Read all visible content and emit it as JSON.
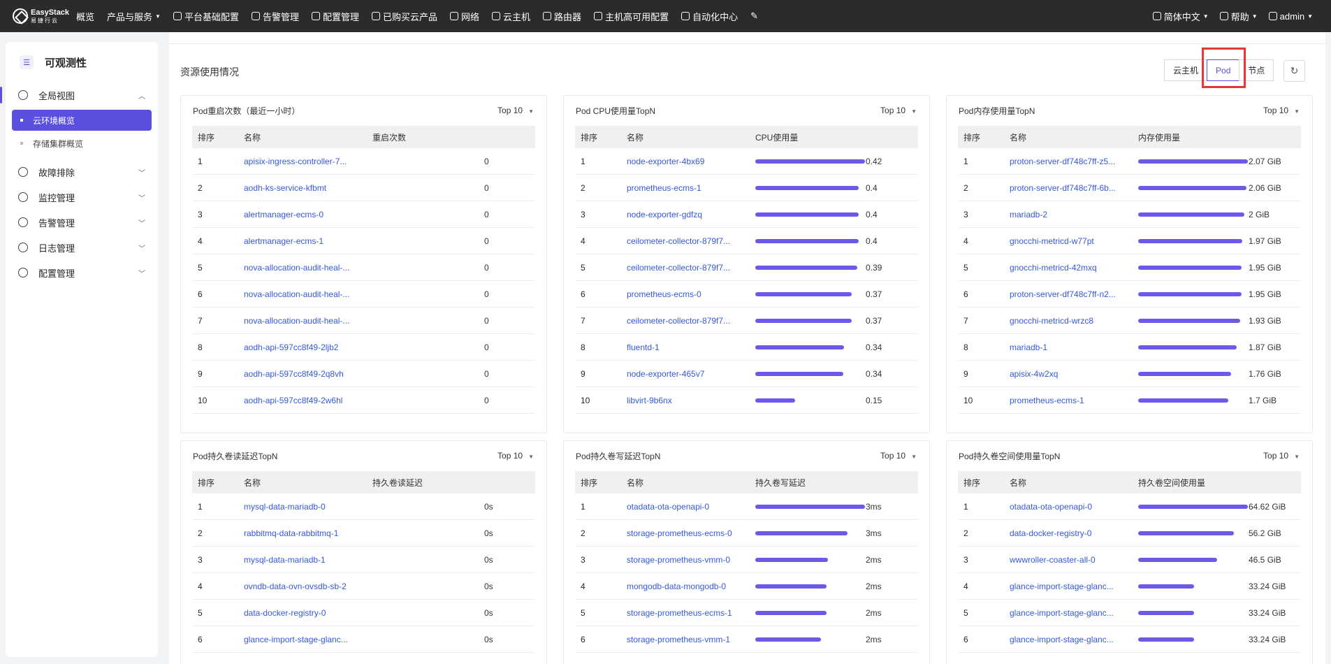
{
  "topbar": {
    "logo_text": "EasyStack",
    "logo_sub": "易捷行云",
    "nav": [
      "概览",
      "产品与服务",
      "平台基础配置",
      "告警管理",
      "配置管理",
      "已购买云产品",
      "网络",
      "云主机",
      "路由器",
      "主机高可用配置",
      "自动化中心"
    ],
    "lang": "简体中文",
    "help": "帮助",
    "user": "admin"
  },
  "sidebar": {
    "title": "可观测性",
    "groups": [
      {
        "label": "全局视图",
        "expanded": true,
        "subs": [
          {
            "label": "云环境概览",
            "active": true
          },
          {
            "label": "存储集群概览",
            "active": false
          }
        ]
      },
      {
        "label": "故障排除"
      },
      {
        "label": "监控管理"
      },
      {
        "label": "告警管理"
      },
      {
        "label": "日志管理"
      },
      {
        "label": "配置管理"
      }
    ]
  },
  "main": {
    "section_title": "资源使用情况",
    "tabs": [
      "云主机",
      "Pod",
      "节点"
    ],
    "active_tab": "Pod"
  },
  "panels": [
    {
      "title": "Pod重启次数（最近一小时）",
      "topn": "Top 10",
      "headers": [
        "排序",
        "名称",
        "重启次数"
      ],
      "bars": false,
      "rows": [
        {
          "i": "1",
          "name": "apisix-ingress-controller-7...",
          "val": "0",
          "pct": 0
        },
        {
          "i": "2",
          "name": "aodh-ks-service-kfbmt",
          "val": "0",
          "pct": 0
        },
        {
          "i": "3",
          "name": "alertmanager-ecms-0",
          "val": "0",
          "pct": 0
        },
        {
          "i": "4",
          "name": "alertmanager-ecms-1",
          "val": "0",
          "pct": 0
        },
        {
          "i": "5",
          "name": "nova-allocation-audit-heal-...",
          "val": "0",
          "pct": 0
        },
        {
          "i": "6",
          "name": "nova-allocation-audit-heal-...",
          "val": "0",
          "pct": 0
        },
        {
          "i": "7",
          "name": "nova-allocation-audit-heal-...",
          "val": "0",
          "pct": 0
        },
        {
          "i": "8",
          "name": "aodh-api-597cc8f49-2ljb2",
          "val": "0",
          "pct": 0
        },
        {
          "i": "9",
          "name": "aodh-api-597cc8f49-2q8vh",
          "val": "0",
          "pct": 0
        },
        {
          "i": "10",
          "name": "aodh-api-597cc8f49-2w6hl",
          "val": "0",
          "pct": 0
        }
      ]
    },
    {
      "title": "Pod CPU使用量TopN",
      "topn": "Top 10",
      "headers": [
        "排序",
        "名称",
        "CPU使用量"
      ],
      "bars": true,
      "rows": [
        {
          "i": "1",
          "name": "node-exporter-4bx69",
          "val": "0.42",
          "pct": 1.0
        },
        {
          "i": "2",
          "name": "prometheus-ecms-1",
          "val": "0.4",
          "pct": 0.94
        },
        {
          "i": "3",
          "name": "node-exporter-gdfzq",
          "val": "0.4",
          "pct": 0.94
        },
        {
          "i": "4",
          "name": "ceilometer-collector-879f7...",
          "val": "0.4",
          "pct": 0.94
        },
        {
          "i": "5",
          "name": "ceilometer-collector-879f7...",
          "val": "0.39",
          "pct": 0.93
        },
        {
          "i": "6",
          "name": "prometheus-ecms-0",
          "val": "0.37",
          "pct": 0.88
        },
        {
          "i": "7",
          "name": "ceilometer-collector-879f7...",
          "val": "0.37",
          "pct": 0.88
        },
        {
          "i": "8",
          "name": "fluentd-1",
          "val": "0.34",
          "pct": 0.81
        },
        {
          "i": "9",
          "name": "node-exporter-465v7",
          "val": "0.34",
          "pct": 0.8
        },
        {
          "i": "10",
          "name": "libvirt-9b6nx",
          "val": "0.15",
          "pct": 0.36
        }
      ]
    },
    {
      "title": "Pod内存使用量TopN",
      "topn": "Top 10",
      "headers": [
        "排序",
        "名称",
        "内存使用量"
      ],
      "bars": true,
      "rows": [
        {
          "i": "1",
          "name": "proton-server-df748c7ff-z5...",
          "val": "2.07 GiB",
          "pct": 1.0
        },
        {
          "i": "2",
          "name": "proton-server-df748c7ff-6b...",
          "val": "2.06 GiB",
          "pct": 0.99
        },
        {
          "i": "3",
          "name": "mariadb-2",
          "val": "2 GiB",
          "pct": 0.97
        },
        {
          "i": "4",
          "name": "gnocchi-metricd-w77pt",
          "val": "1.97 GiB",
          "pct": 0.95
        },
        {
          "i": "5",
          "name": "gnocchi-metricd-42mxq",
          "val": "1.95 GiB",
          "pct": 0.94
        },
        {
          "i": "6",
          "name": "proton-server-df748c7ff-n2...",
          "val": "1.95 GiB",
          "pct": 0.94
        },
        {
          "i": "7",
          "name": "gnocchi-metricd-wrzc8",
          "val": "1.93 GiB",
          "pct": 0.93
        },
        {
          "i": "8",
          "name": "mariadb-1",
          "val": "1.87 GiB",
          "pct": 0.9
        },
        {
          "i": "9",
          "name": "apisix-4w2xq",
          "val": "1.76 GiB",
          "pct": 0.85
        },
        {
          "i": "10",
          "name": "prometheus-ecms-1",
          "val": "1.7 GiB",
          "pct": 0.82
        }
      ]
    },
    {
      "title": "Pod持久卷读延迟TopN",
      "topn": "Top 10",
      "headers": [
        "排序",
        "名称",
        "持久卷读延迟"
      ],
      "bars": false,
      "rows": [
        {
          "i": "1",
          "name": "mysql-data-mariadb-0",
          "val": "0s",
          "pct": 0
        },
        {
          "i": "2",
          "name": "rabbitmq-data-rabbitmq-1",
          "val": "0s",
          "pct": 0
        },
        {
          "i": "3",
          "name": "mysql-data-mariadb-1",
          "val": "0s",
          "pct": 0
        },
        {
          "i": "4",
          "name": "ovndb-data-ovn-ovsdb-sb-2",
          "val": "0s",
          "pct": 0
        },
        {
          "i": "5",
          "name": "data-docker-registry-0",
          "val": "0s",
          "pct": 0
        },
        {
          "i": "6",
          "name": "glance-import-stage-glanc...",
          "val": "0s",
          "pct": 0
        }
      ]
    },
    {
      "title": "Pod持久卷写延迟TopN",
      "topn": "Top 10",
      "headers": [
        "排序",
        "名称",
        "持久卷写延迟"
      ],
      "bars": true,
      "rows": [
        {
          "i": "1",
          "name": "otadata-ota-openapi-0",
          "val": "3ms",
          "pct": 1.0
        },
        {
          "i": "2",
          "name": "storage-prometheus-ecms-0",
          "val": "3ms",
          "pct": 0.84
        },
        {
          "i": "3",
          "name": "storage-prometheus-vmm-0",
          "val": "2ms",
          "pct": 0.66
        },
        {
          "i": "4",
          "name": "mongodb-data-mongodb-0",
          "val": "2ms",
          "pct": 0.65
        },
        {
          "i": "5",
          "name": "storage-prometheus-ecms-1",
          "val": "2ms",
          "pct": 0.65
        },
        {
          "i": "6",
          "name": "storage-prometheus-vmm-1",
          "val": "2ms",
          "pct": 0.6
        }
      ]
    },
    {
      "title": "Pod持久卷空间使用量TopN",
      "topn": "Top 10",
      "headers": [
        "排序",
        "名称",
        "持久卷空间使用量"
      ],
      "bars": true,
      "rows": [
        {
          "i": "1",
          "name": "otadata-ota-openapi-0",
          "val": "64.62 GiB",
          "pct": 1.0
        },
        {
          "i": "2",
          "name": "data-docker-registry-0",
          "val": "56.2 GiB",
          "pct": 0.87
        },
        {
          "i": "3",
          "name": "wwwroller-coaster-all-0",
          "val": "46.5 GiB",
          "pct": 0.72
        },
        {
          "i": "4",
          "name": "glance-import-stage-glanc...",
          "val": "33.24 GiB",
          "pct": 0.51
        },
        {
          "i": "5",
          "name": "glance-import-stage-glanc...",
          "val": "33.24 GiB",
          "pct": 0.51
        },
        {
          "i": "6",
          "name": "glance-import-stage-glanc...",
          "val": "33.24 GiB",
          "pct": 0.51
        }
      ]
    }
  ]
}
